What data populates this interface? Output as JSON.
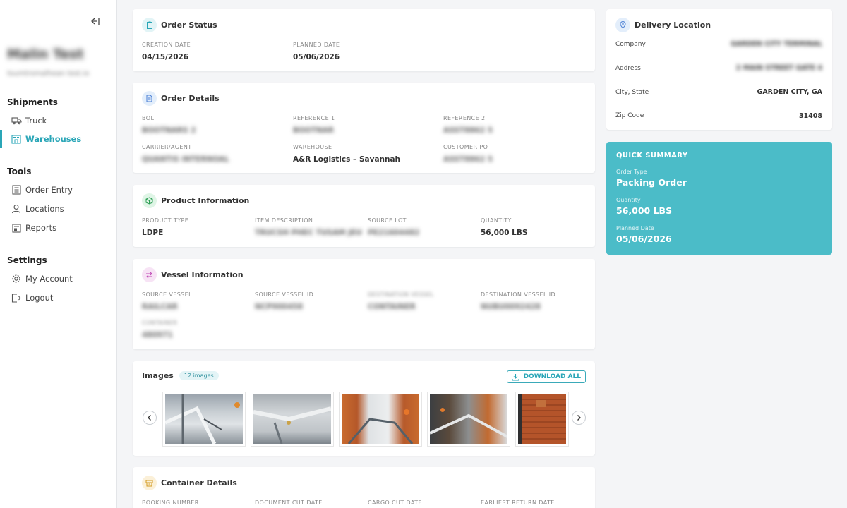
{
  "sidebar": {
    "user_name": "Malin Test",
    "user_email": "tsumtrsmalhean test.io",
    "sections": [
      {
        "title": "Shipments",
        "items": [
          {
            "label": "Truck",
            "icon": "truck-icon"
          },
          {
            "label": "Warehouses",
            "icon": "warehouse-icon",
            "active": true
          }
        ]
      },
      {
        "title": "Tools",
        "items": [
          {
            "label": "Order Entry",
            "icon": "order-entry-icon"
          },
          {
            "label": "Locations",
            "icon": "user-icon"
          },
          {
            "label": "Reports",
            "icon": "reports-icon"
          }
        ]
      },
      {
        "title": "Settings",
        "items": [
          {
            "label": "My Account",
            "icon": "gear-icon"
          },
          {
            "label": "Logout",
            "icon": "logout-icon"
          }
        ]
      }
    ]
  },
  "order_status": {
    "title": "Order Status",
    "creation_label": "CREATION DATE",
    "creation_value": "04/15/2026",
    "planned_label": "PLANNED DATE",
    "planned_value": "05/06/2026"
  },
  "order_details": {
    "title": "Order Details",
    "fields": [
      {
        "label": "BOL",
        "value": "BOOTNARS 2"
      },
      {
        "label": "REFERENCE 1",
        "value": "BOOTNAR"
      },
      {
        "label": "REFERENCE 2",
        "value": "ASST8862 5"
      },
      {
        "label": "CARRIER/AGENT",
        "value": "QUANTIS INTERNOAL"
      },
      {
        "label": "WAREHOUSE",
        "value": "A&R Logistics – Savannah"
      },
      {
        "label": "CUSTOMER PO",
        "value": "ASST8862 5"
      }
    ]
  },
  "product_info": {
    "title": "Product Information",
    "fields": [
      {
        "label": "PRODUCT TYPE",
        "value": "LDPE"
      },
      {
        "label": "ITEM DESCRIPTION",
        "value": "TRUCSH PHEC TUSAM JEU"
      },
      {
        "label": "SOURCE LOT",
        "value": "PE21604482"
      },
      {
        "label": "QUANTITY",
        "value": "56,000 LBS"
      }
    ]
  },
  "vessel_info": {
    "title": "Vessel Information",
    "fields": [
      {
        "label": "SOURCE VESSEL",
        "value": "RAILCAR"
      },
      {
        "label": "SOURCE VESSEL ID",
        "value": "NCP900458"
      },
      {
        "label": "DESTINATION VESSEL",
        "value": "CONTAINER"
      },
      {
        "label": "DESTINATION VESSEL ID",
        "value": "NUBU0092428"
      },
      {
        "label": "CONTAINER",
        "value": "480971"
      }
    ]
  },
  "images": {
    "title": "Images",
    "count_label": "12 images",
    "download_label": "DOWNLOAD ALL"
  },
  "container_details": {
    "title": "Container Details",
    "fields": [
      {
        "label": "BOOKING NUMBER"
      },
      {
        "label": "DOCUMENT CUT DATE"
      },
      {
        "label": "CARGO CUT DATE"
      },
      {
        "label": "EARLIEST RETURN DATE"
      }
    ]
  },
  "delivery": {
    "title": "Delivery Location",
    "rows": [
      {
        "key": "Company",
        "value": "GARDEN CITY TERMINAL"
      },
      {
        "key": "Address",
        "value": "2 MAIN STREET GATE 4"
      },
      {
        "key": "City, State",
        "value": "GARDEN CITY, GA"
      },
      {
        "key": "Zip Code",
        "value": "31408"
      }
    ]
  },
  "summary": {
    "title": "QUICK SUMMARY",
    "order_type_label": "Order Type",
    "order_type_value": "Packing Order",
    "quantity_label": "Quantity",
    "quantity_value": "56,000 LBS",
    "planned_label": "Planned Date",
    "planned_value": "05/06/2026"
  },
  "colors": {
    "accent": "#2aa6b7",
    "summary_bg": "#4bbcc8"
  }
}
